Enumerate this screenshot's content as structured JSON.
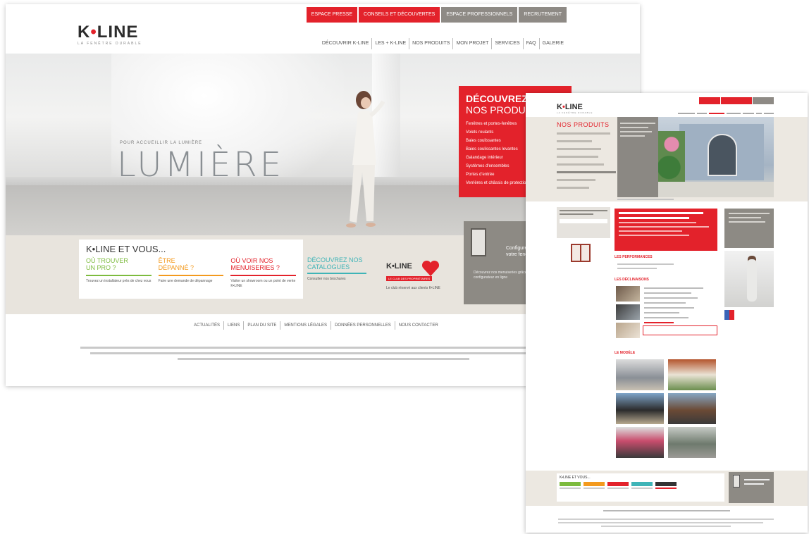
{
  "colors": {
    "brand_red": "#e3222b",
    "warm_gray": "#8e8a85",
    "beige_band": "#e8e4dd",
    "teal": "#3fb4b7",
    "orange": "#f39a1e",
    "green": "#7dbb3e"
  },
  "home": {
    "topbar": [
      {
        "label": "ESPACE PRESSE",
        "style": "red"
      },
      {
        "label": "CONSEILS ET DÉCOUVERTES",
        "style": "red"
      },
      {
        "label": "ESPACE PROFESSIONNELS",
        "style": "gray"
      },
      {
        "label": "RECRUTEMENT",
        "style": "gray"
      }
    ],
    "logo": {
      "name_left": "K",
      "dot": "•",
      "name_right": "LINE",
      "tagline": "LA FENÊTRE DURABLE"
    },
    "nav": [
      "DÉCOUVRIR K-LINE",
      "LES + K-LINE",
      "NOS PRODUITS",
      "MON PROJET",
      "SERVICES",
      "FAQ",
      "GALERIE"
    ],
    "hero": {
      "tagline": "POUR ACCUEILLIR LA LUMIÈRE",
      "headline": "LUMIÈRE"
    },
    "promo": {
      "title_bold": "DÉCOUVREZ",
      "title_light": "NOS PRODUITS",
      "items": [
        "Fenêtres et portes-fenêtres",
        "Volets roulants",
        "Baies coulissantes",
        "Baies coulissantes levantes",
        "Galandage intérieur",
        "Systèmes d'ensembles",
        "Portes d'entrée",
        "Verrières et châssis de protection"
      ]
    },
    "vous": {
      "title": "K•LINE ET VOUS...",
      "columns": [
        {
          "line1": "OÙ TROUVER",
          "line2": "UN PRO ?",
          "color": "#7dbb3e",
          "desc": "Trouvez un installateur près de chez vous"
        },
        {
          "line1": "ÊTRE",
          "line2": "DÉPANNÉ ?",
          "color": "#f39a1e",
          "desc": "Faire une demande de dépannage"
        },
        {
          "line1": "OÙ VOIR NOS",
          "line2": "MENUISERIES ?",
          "color": "#e3222b",
          "desc": "Visiter un showroom ou un point de vente K•LINE"
        }
      ]
    },
    "catalogues": {
      "line1": "DÉCOUVREZ NOS",
      "line2": "CATALOGUES",
      "desc": "Consulter nos brochures"
    },
    "club": {
      "name": "K•LINE",
      "badge": "LE CLUB DES PROPRIÉTAIRES",
      "desc": "Le club réservé aux clients K•LINE"
    },
    "showroom": {
      "title_line1": "Configurer",
      "title_line2": "votre fenêtre",
      "desc": "Découvrez nos menuiseries grâce au configurateur en ligne"
    },
    "footer_nav": [
      "ACTUALITÉS",
      "LIENS",
      "PLAN DU SITE",
      "MENTIONS LÉGALES",
      "DONNÉES PERSONNELLES",
      "NOUS CONTACTER"
    ]
  },
  "products": {
    "logo": {
      "name_left": "K",
      "dot": "•",
      "name_right": "LINE",
      "tagline": "LA FENÊTRE DURABLE"
    },
    "page_title": "NOS PRODUITS",
    "sections": [
      "LES PERFORMANCES",
      "LES DÉCLINAISONS",
      "LE MODÈLE"
    ],
    "bottom_card_title": "K•LINE ET VOUS..."
  }
}
